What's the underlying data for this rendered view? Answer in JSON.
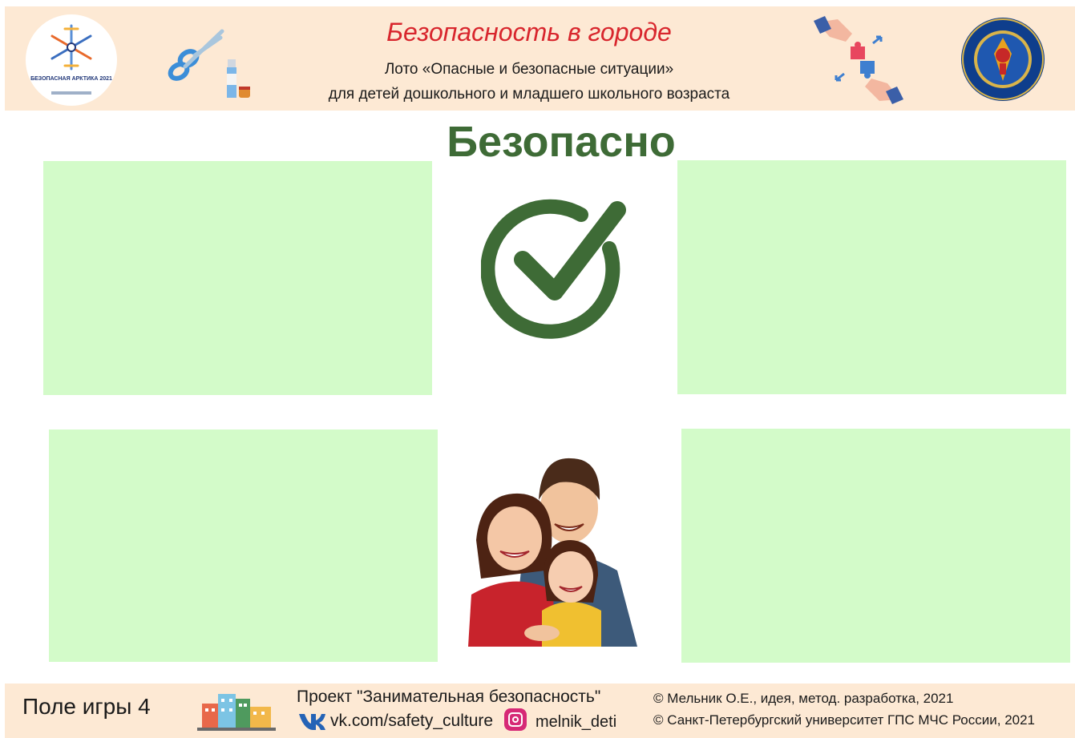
{
  "header": {
    "title": "Безопасность в городе",
    "subtitle_line1": "Лото «Опасные и безопасные ситуации»",
    "subtitle_line2": "для детей дошкольного и младшего школьного возраста",
    "logo_left_text": "БЕЗОПАСНАЯ АРКТИКА 2021",
    "logo_left_icon": "snowflake-logo",
    "logo_right_icon": "university-emblem",
    "decor_left_icons": [
      "scissors-icon",
      "glue-icon"
    ],
    "decor_right_icon": "puzzle-hands-icon"
  },
  "main": {
    "title": "Безопасно",
    "center_icon": "checkmark-circle-icon",
    "center_illustration": "family-illustration",
    "cards": [
      "empty",
      "empty",
      "empty",
      "empty"
    ]
  },
  "footer": {
    "field_label": "Поле игры 4",
    "project_name": "Проект \"Занимательная безопасность\"",
    "vk_link": "vk.com/safety_culture",
    "instagram_handle": "melnik_deti",
    "copyright1": "© Мельник О.Е.,  идея, метод. разработка, 2021",
    "copyright2": "© Санкт-Петербургский университет ГПС МЧС России, 2021"
  },
  "colors": {
    "header_bg": "#fde9d4",
    "title_red": "#d8262d",
    "safe_green": "#3e6b36",
    "card_green": "#d3fbc9"
  }
}
